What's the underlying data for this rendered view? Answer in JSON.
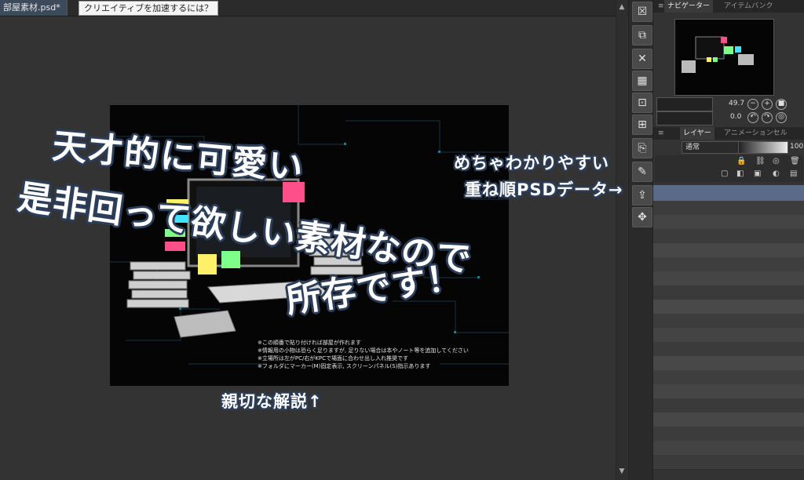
{
  "tabs": {
    "document": "部屋素材.psd*",
    "tip": "クリエイティブを加速するには？"
  },
  "canvas": {
    "notes": [
      "※この順番で貼り付ければ部屋が作れます",
      "※情報用の小物は恐らく足りますが, 足りない場合は本やノート等を追加してください",
      "※立場所は左がPC/右がKPCで場面に合わせ出し入れ推奨です",
      "※フォルダにマーカー(M)固定表示, スクリーンパネル(S)指示あります"
    ]
  },
  "overlay": {
    "line1": "天才的に可愛い",
    "line2": "是非回って欲しい素材なので",
    "line3": "所存です！",
    "annotation_top1": "めちゃわかりやすい",
    "annotation_top2": "重ね順PSDデータ→",
    "annotation_bottom": "親切な解説↑"
  },
  "right_panel": {
    "navigator_tab": "ナビゲーター",
    "item_bank_tab": "アイテムバンク",
    "zoom_value": "49.7",
    "rotation_value": "0.0",
    "layer_tab": "レイヤー",
    "animation_tab": "アニメーションセル",
    "blend_mode": "通常",
    "opacity": "100"
  },
  "colors": {
    "overlay_outline": "#2c3e59",
    "note_pink": "#ff4f8b",
    "note_yellow": "#fff06a",
    "note_green": "#7dff8a",
    "note_cyan": "#45e0ff"
  }
}
